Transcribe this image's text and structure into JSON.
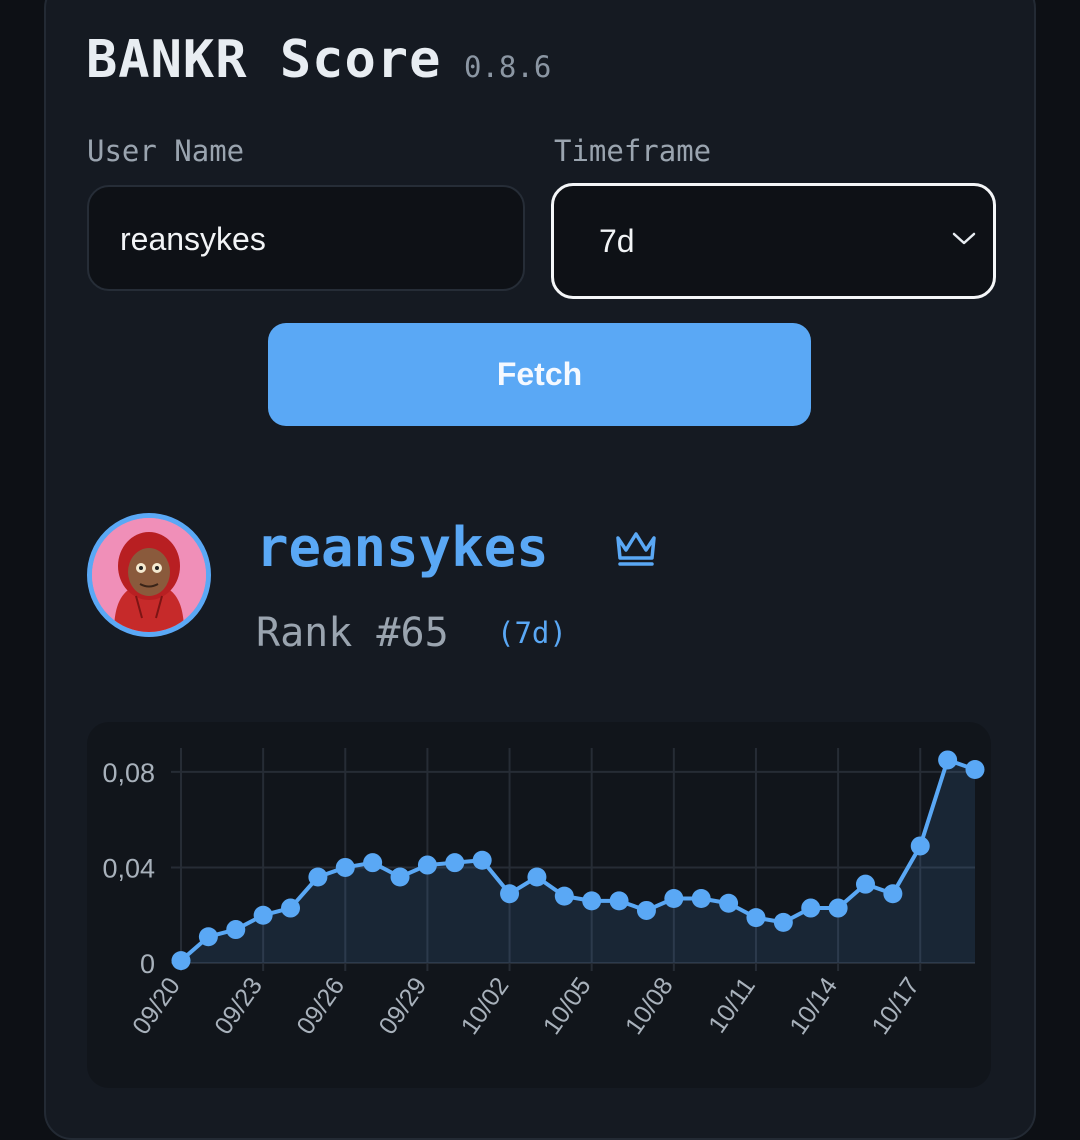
{
  "app": {
    "title": "BANKR Score",
    "version": "0.8.6"
  },
  "form": {
    "username_label": "User Name",
    "username_value": "reansykes",
    "timeframe_label": "Timeframe",
    "timeframe_value": "7d",
    "fetch_label": "Fetch"
  },
  "profile": {
    "username": "reansykes",
    "rank": "Rank #65",
    "timeframe": "(7d)",
    "badge_icon": "crown-icon"
  },
  "colors": {
    "accent": "#5aa8f5",
    "background": "#0d1015",
    "card": "#151a22"
  },
  "chart_data": {
    "type": "area",
    "x": [
      "09/20",
      "09/21",
      "09/22",
      "09/23",
      "09/24",
      "09/25",
      "09/26",
      "09/27",
      "09/28",
      "09/29",
      "09/30",
      "10/01",
      "10/02",
      "10/03",
      "10/04",
      "10/05",
      "10/06",
      "10/07",
      "10/08",
      "10/09",
      "10/10",
      "10/11",
      "10/12",
      "10/13",
      "10/14",
      "10/15",
      "10/16",
      "10/17",
      "10/18",
      "10/19"
    ],
    "x_tick_labels": [
      "09/20",
      "09/23",
      "09/26",
      "09/29",
      "10/02",
      "10/05",
      "10/08",
      "10/11",
      "10/14",
      "10/17"
    ],
    "y_tick_labels": [
      "0",
      "0,04",
      "0,08"
    ],
    "y_ticks": [
      0,
      0.04,
      0.08
    ],
    "series": [
      {
        "values": [
          0.001,
          0.011,
          0.014,
          0.02,
          0.023,
          0.036,
          0.04,
          0.042,
          0.036,
          0.041,
          0.042,
          0.043,
          0.029,
          0.036,
          0.028,
          0.026,
          0.026,
          0.022,
          0.027,
          0.027,
          0.025,
          0.019,
          0.017,
          0.023,
          0.023,
          0.033,
          0.029,
          0.049,
          0.085,
          0.081
        ]
      }
    ],
    "ylim": [
      0,
      0.09
    ],
    "grid": true,
    "xlabel": "",
    "ylabel": ""
  }
}
